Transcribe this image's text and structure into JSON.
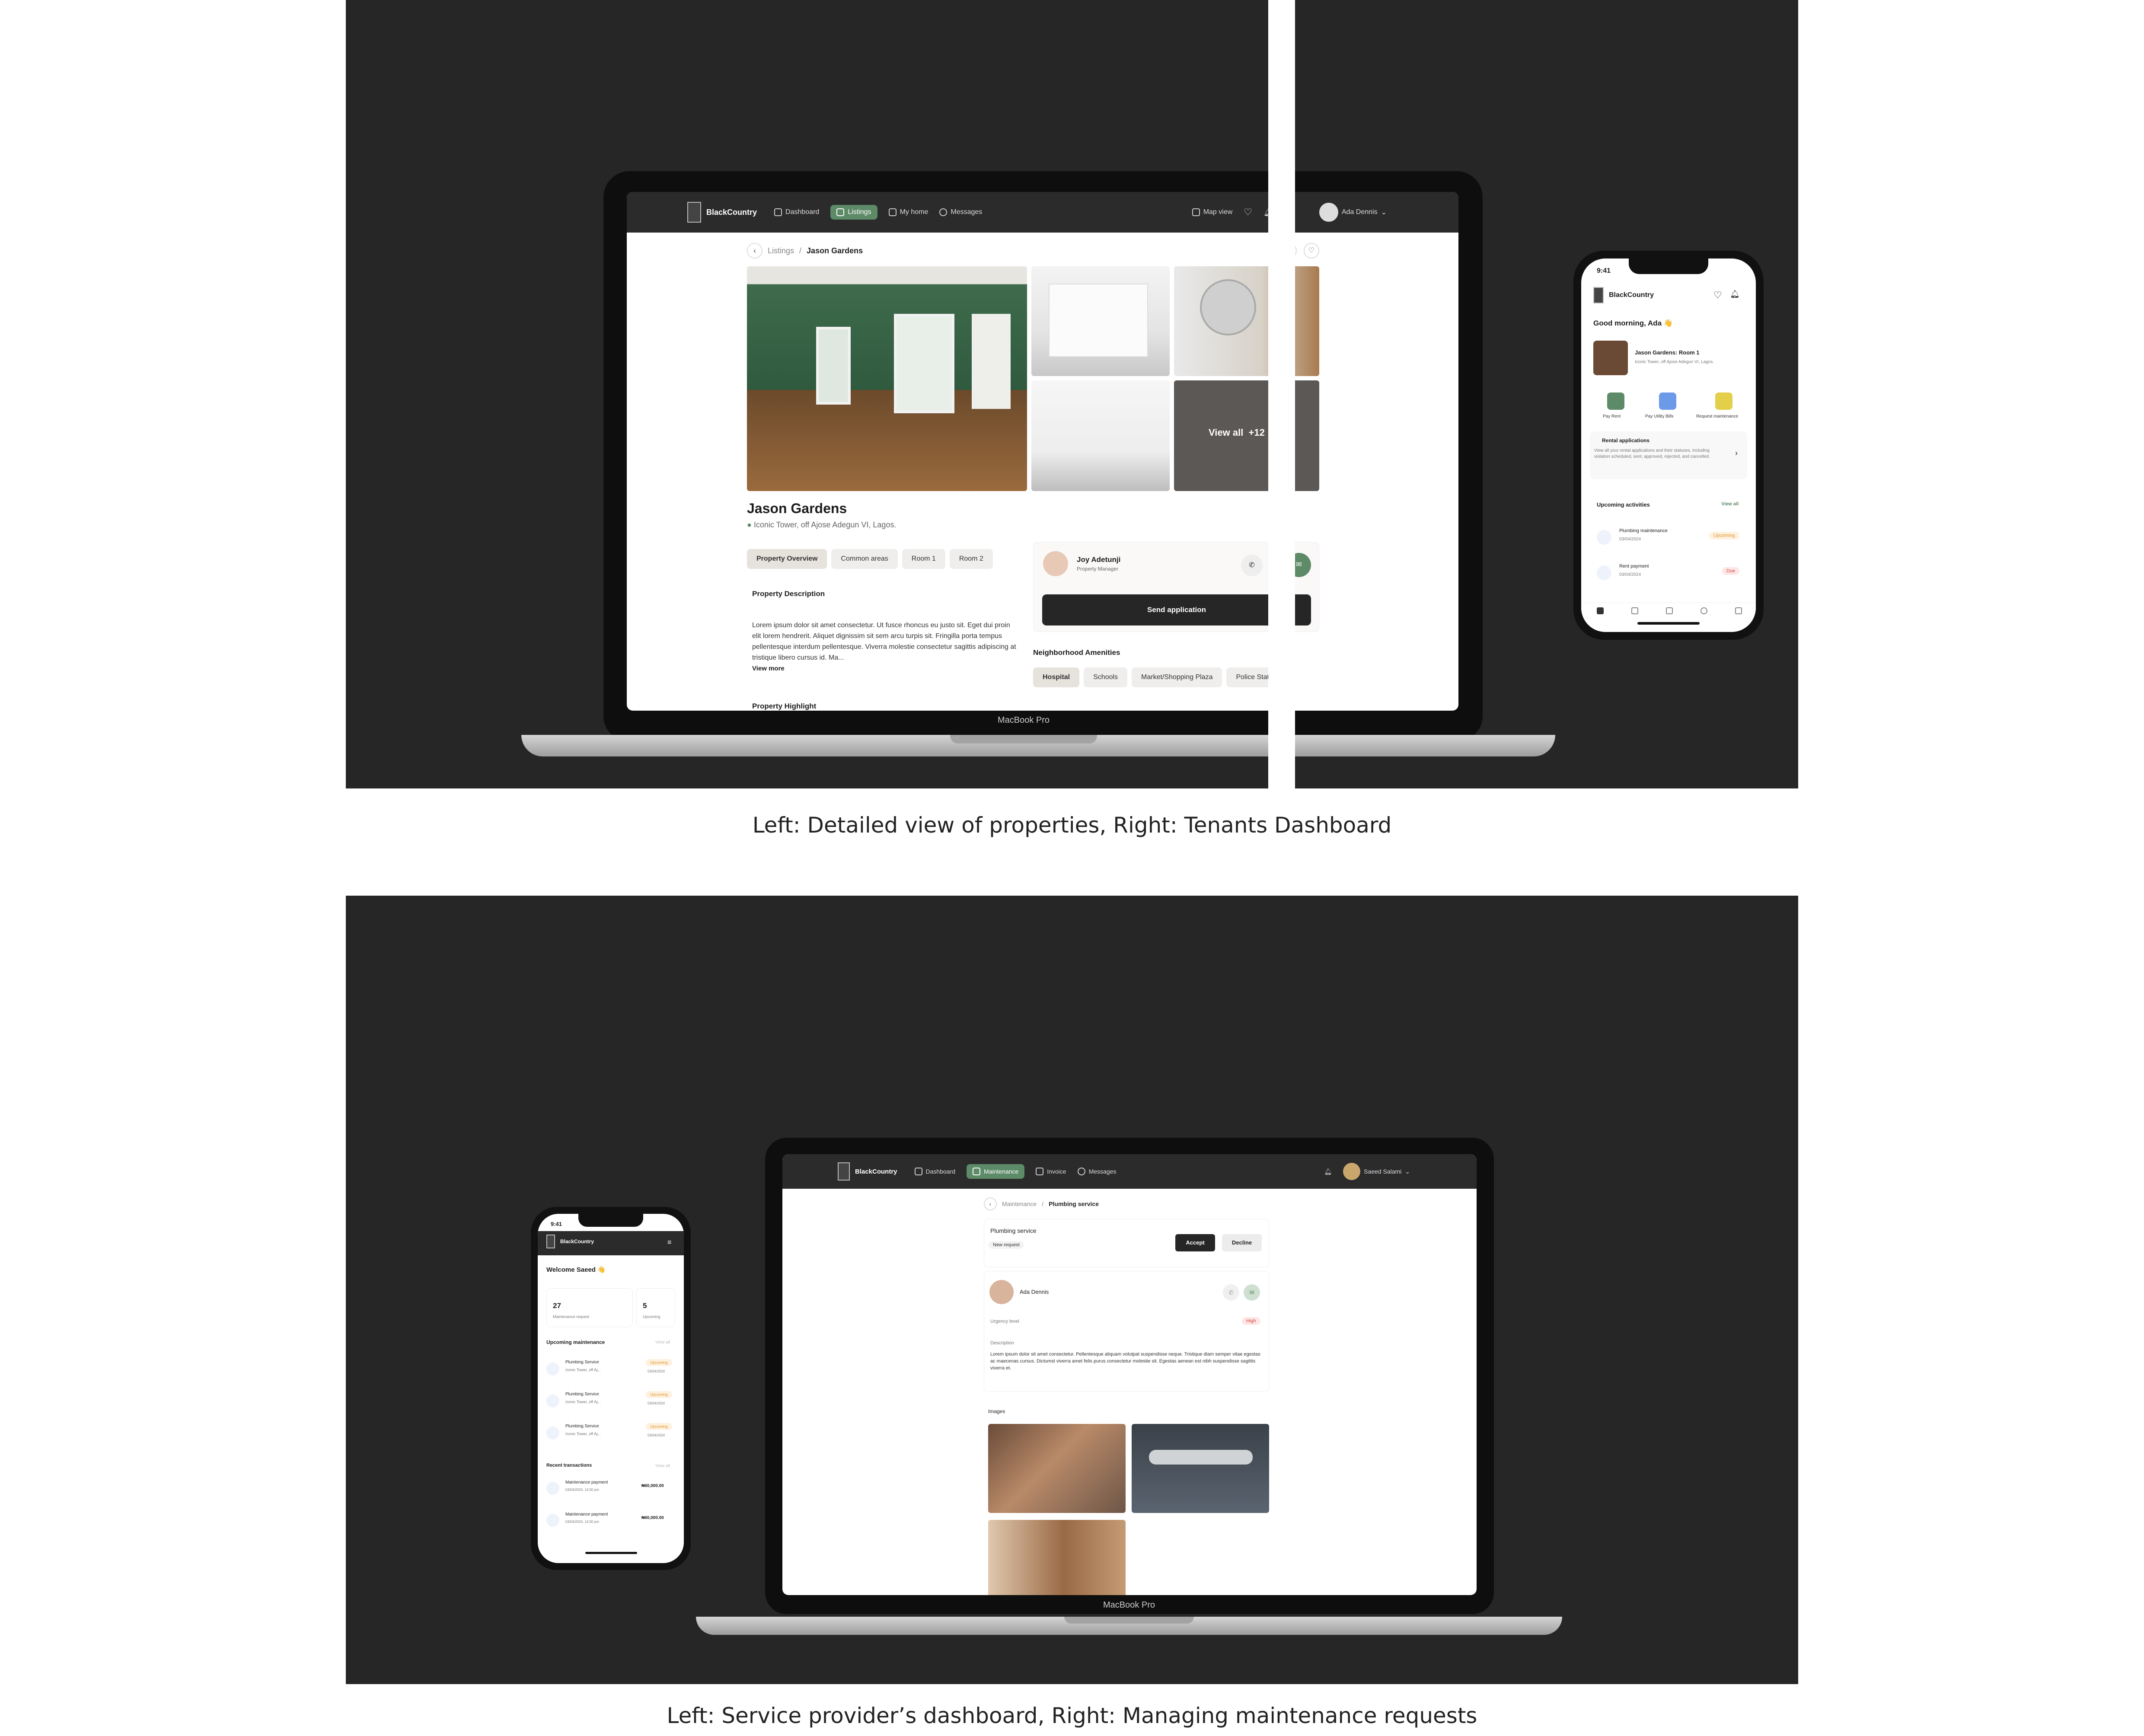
{
  "captions": {
    "top": "Left: Detailed view of properties, Right: Tenants Dashboard",
    "bottom": "Left: Service provider’s dashboard, Right: Managing maintenance requests"
  },
  "device_label": "MacBook Pro",
  "brand": "BlackCountry",
  "listing": {
    "nav": {
      "items": [
        "Dashboard",
        "Listings",
        "My home",
        "Messages"
      ],
      "map_view": "Map view",
      "user": "Ada Dennis"
    },
    "breadcrumb": {
      "parent": "Listings",
      "current": "Jason Gardens"
    },
    "view_all": "View all",
    "view_all_count": "+12",
    "title": "Jason Gardens",
    "address": "Iconic Tower, off Ajose Adegun VI, Lagos.",
    "tabs": [
      "Property Overview",
      "Common areas",
      "Room 1",
      "Room 2"
    ],
    "description_title": "Property Description",
    "description": "Lorem ipsum dolor sit amet consectetur. Ut fusce rhoncus eu justo sit. Eget dui proin elit lorem hendrerit. Aliquet dignissim sit sem arcu turpis sit. Fringilla porta tempus pellentesque interdum pellentesque. Viverra molestie consectetur sagittis adipiscing at tristique libero cursus id. Ma...",
    "view_more": "View more",
    "highlight_title": "Property Highlight",
    "manager": {
      "name": "Joy Adetunji",
      "role": "Property Manager"
    },
    "send_application": "Send application",
    "amenities_title": "Neighborhood Amenities",
    "amenities": [
      "Hospital",
      "Schools",
      "Market/Shopping Plaza",
      "Police Station"
    ]
  },
  "tenant_phone": {
    "time": "9:41",
    "greeting": "Good morning, Ada 👋",
    "home_title": "Jason Gardens: Room 1",
    "home_address": "Iconic Tower, off Ajose Adegun VI, Lagos.",
    "actions": [
      "Pay Rent",
      "Pay Utility Bills",
      "Request maintenance"
    ],
    "rental_title": "Rental applications",
    "rental_text": "View all your rental applications and their statuses, including violation scheduled, sent, approved, rejected, and cancelled.",
    "upcoming_title": "Upcoming activities",
    "view_all": "View all",
    "activities": [
      {
        "title": "Plumbing maintenance",
        "date": "03/04/2024",
        "status": "Upcoming"
      },
      {
        "title": "Rent payment",
        "date": "03/04/2024",
        "status": "Due"
      }
    ]
  },
  "provider_phone": {
    "time": "9:41",
    "greeting": "Welcome Saeed 👋",
    "stats": [
      {
        "value": "27",
        "label": "Maintenance request"
      },
      {
        "value": "5",
        "label": "Upcoming"
      }
    ],
    "upcoming_title": "Upcoming maintenance",
    "view_all": "View all",
    "items": [
      {
        "title": "Plumbing Service",
        "address": "Iconic Tower, off Aj...",
        "status": "Upcoming",
        "date": "03/04/2024"
      },
      {
        "title": "Plumbing Service",
        "address": "Iconic Tower, off Aj...",
        "status": "Upcoming",
        "date": "03/04/2024"
      },
      {
        "title": "Plumbing Service",
        "address": "Iconic Tower, off Aj...",
        "status": "Upcoming",
        "date": "03/04/2024"
      }
    ],
    "transactions_title": "Recent transactions",
    "transactions": [
      {
        "title": "Maintenance payment",
        "date": "03/04/2024, 14:00 pm",
        "amount": "₦60,000.00"
      },
      {
        "title": "Maintenance payment",
        "date": "03/04/2024, 14:00 pm",
        "amount": "₦60,000.00"
      }
    ]
  },
  "maintenance": {
    "nav": {
      "items": [
        "Dashboard",
        "Maintenance",
        "Invoice",
        "Messages"
      ],
      "user": "Saeed Salami"
    },
    "breadcrumb": {
      "parent": "Maintenance",
      "current": "Plumbing service"
    },
    "service": "Plumbing service",
    "status": "New request",
    "accept": "Accept",
    "decline": "Decline",
    "tenant": "Ada Dennis",
    "urgency_label": "Urgency level",
    "urgency": "High",
    "description_label": "Description",
    "description": "Lorem ipsum dolor sit amet consectetur. Pellentesque aliquam volutpat suspendisse neque. Tristique diam semper vitae egestas ac maecenas cursus. Dictumst viverra amet felis purus consectetur molestie sit. Egestas aenean est nibh suspendisse sagittis viverra et.",
    "images_label": "Images"
  },
  "colors": {
    "accent_green": "#5d8a67",
    "panel_bg": "#262626",
    "upcoming": "#f0a431",
    "due": "#e04b4b"
  }
}
